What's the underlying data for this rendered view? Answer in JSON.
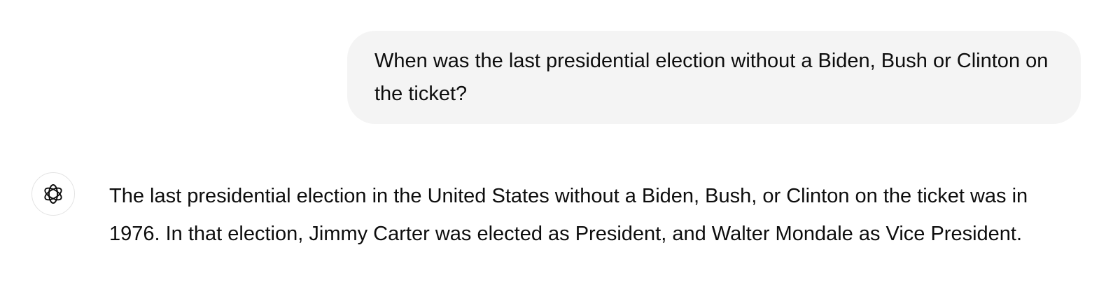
{
  "conversation": {
    "user_message": {
      "text": "When was the last presidential election without a Biden, Bush or Clinton on the ticket?"
    },
    "assistant_message": {
      "avatar_icon": "openai-logo-icon",
      "text": "The last presidential election in the United States without a Biden, Bush, or Clinton on the ticket was in 1976. In that election, Jimmy Carter was elected as President, and Walter Mondale as Vice President."
    }
  },
  "colors": {
    "user_bubble_bg": "#f4f4f4",
    "text": "#0d0d0d",
    "avatar_border": "#e3e3e3"
  }
}
